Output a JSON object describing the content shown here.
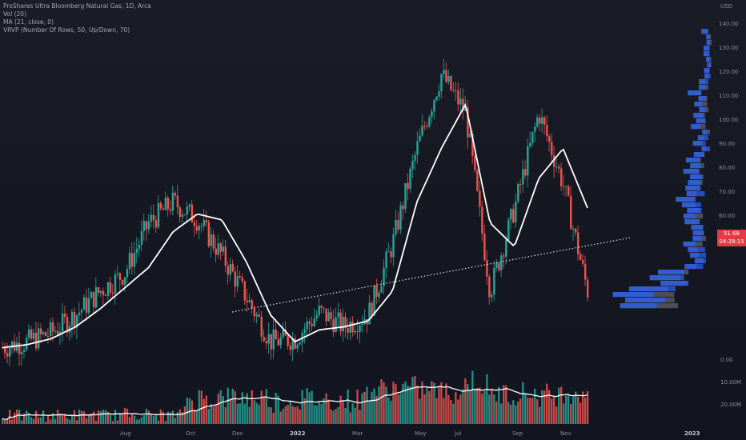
{
  "legend": {
    "title": "ProShares Ultra Bloomberg Natural Gas, 1D, Arca",
    "vol": "Vol (20)",
    "ma": "MA (21, close, 0)",
    "vrvp": "VRVP (Number Of Rows, 50, Up/Down, 70)"
  },
  "axis": {
    "currency": "USD",
    "price_ticks": [
      "140.00",
      "130.00",
      "120.00",
      "110.00",
      "100.00",
      "90.00",
      "80.00",
      "70.00",
      "60.00"
    ],
    "volume_ticks": [
      "0.00",
      "10.00M",
      "20.00M"
    ],
    "month_labels": [
      "Aug",
      "Oct",
      "Dec",
      "2022",
      "Mar",
      "May",
      "Jul",
      "Sep",
      "Nov",
      "2023"
    ]
  },
  "price_tag": {
    "price": "51.68",
    "countdown": "04:39:15"
  },
  "colors": {
    "up": "#26a69a",
    "down": "#ef5350",
    "ma": "#ffffff",
    "vrvp_up": "#2962ff",
    "background": "#131722"
  },
  "chart_data": [
    {
      "type": "line",
      "name": "price",
      "ylim": [
        45,
        140
      ],
      "x": [
        0,
        6,
        12,
        18,
        24,
        30,
        36,
        42,
        48,
        54,
        60,
        66,
        72,
        78,
        84,
        90,
        96,
        102,
        108,
        114,
        120,
        126,
        132,
        138,
        144
      ],
      "ma": [
        33,
        34,
        36,
        40,
        46,
        53,
        60,
        72,
        78,
        76,
        62,
        44,
        35,
        39,
        40,
        42,
        52,
        82,
        100,
        115,
        75,
        67,
        90,
        100,
        80
      ],
      "close": [
        33,
        35,
        38,
        44,
        52,
        58,
        75,
        82,
        76,
        64,
        50,
        35,
        36,
        45,
        40,
        44,
        68,
        100,
        125,
        112,
        52,
        80,
        112,
        88,
        52
      ]
    },
    {
      "type": "bar",
      "name": "volume",
      "ylim": [
        0,
        25
      ],
      "note": "daily volume bars with 20-period average"
    },
    {
      "type": "bar",
      "name": "volume-profile",
      "note": "horizontal volume-by-price histogram on the right"
    }
  ]
}
